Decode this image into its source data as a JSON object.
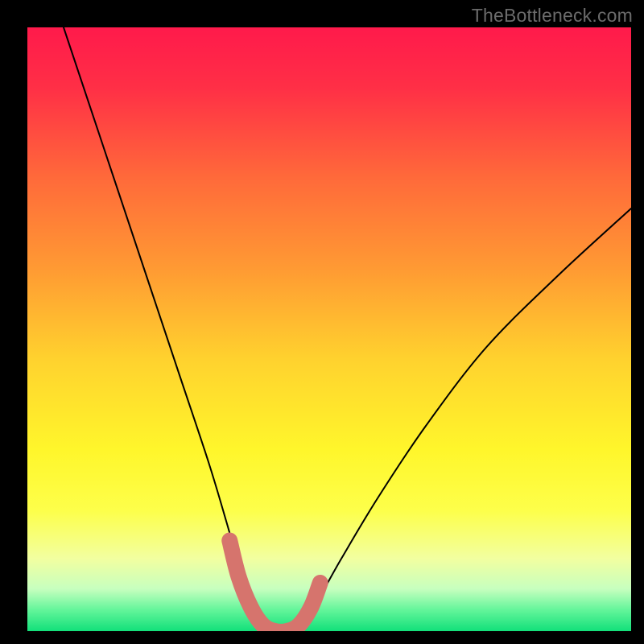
{
  "watermark": {
    "text": "TheBottleneck.com"
  },
  "chart_data": {
    "type": "line",
    "title": "",
    "xlabel": "",
    "ylabel": "",
    "xlim": [
      0,
      100
    ],
    "ylim": [
      0,
      100
    ],
    "grid": false,
    "legend": null,
    "series": [
      {
        "name": "bottleneck-curve",
        "x": [
          6,
          10,
          15,
          20,
          25,
          30,
          33,
          35,
          37,
          39,
          41,
          43,
          45,
          48,
          52,
          58,
          66,
          76,
          88,
          100
        ],
        "y": [
          100,
          88,
          73,
          58,
          43,
          28,
          18,
          11,
          5,
          1,
          0,
          0,
          1,
          5,
          12,
          22,
          34,
          47,
          59,
          70
        ]
      }
    ],
    "highlight": {
      "name": "optimal-zone-marker",
      "x": [
        33.5,
        35,
        37,
        39,
        41,
        43,
        45,
        47,
        48.5
      ],
      "y": [
        15,
        9,
        4,
        1,
        0,
        0,
        1,
        4,
        8
      ]
    },
    "background_gradient_stops": [
      {
        "offset": 0.0,
        "color": "#ff1a4b"
      },
      {
        "offset": 0.1,
        "color": "#ff2f46"
      },
      {
        "offset": 0.25,
        "color": "#ff6a3a"
      },
      {
        "offset": 0.4,
        "color": "#ff9a33"
      },
      {
        "offset": 0.55,
        "color": "#ffd22e"
      },
      {
        "offset": 0.7,
        "color": "#fff62b"
      },
      {
        "offset": 0.8,
        "color": "#fdff4a"
      },
      {
        "offset": 0.88,
        "color": "#f2ffa0"
      },
      {
        "offset": 0.93,
        "color": "#c7ffbf"
      },
      {
        "offset": 0.965,
        "color": "#63f59a"
      },
      {
        "offset": 1.0,
        "color": "#12e07a"
      }
    ]
  }
}
